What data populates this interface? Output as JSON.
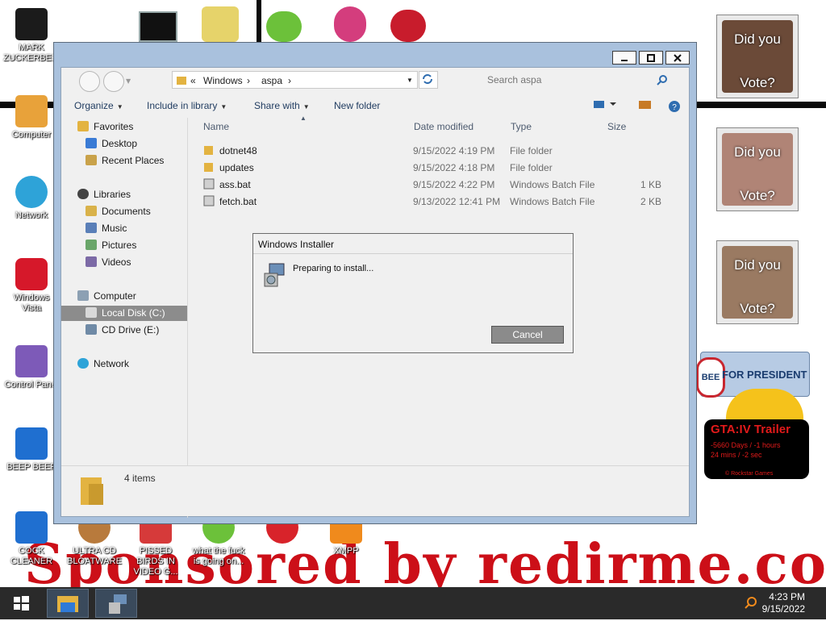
{
  "wallpaper": {
    "banner": "",
    "sponsor": "Sponsored by redirme.com"
  },
  "desktop_icons": [
    {
      "label": "MARK ZUCKERBERG"
    },
    {
      "label": "Computer"
    },
    {
      "label": "Network"
    },
    {
      "label": "Windows Vista"
    },
    {
      "label": "Control Panel"
    },
    {
      "label": "BEEP BEEP"
    },
    {
      "label": "COCK CLEANER"
    },
    {
      "label": "ULTRA CD BLOATWARE"
    },
    {
      "label": "PISSED BIRDS IN VIDEO G..."
    },
    {
      "label": "what the fuck is going on..."
    },
    {
      "label": ""
    },
    {
      "label": "XMPP"
    }
  ],
  "vote_widgets": [
    {
      "line1": "Did you",
      "line2": "Vote?"
    },
    {
      "line1": "Did you",
      "line2": "Vote?"
    },
    {
      "line1": "Did you",
      "line2": "Vote?"
    }
  ],
  "president_widget": {
    "badge": "BEE",
    "text": "FOR PRESIDENT"
  },
  "gta_widget": {
    "title": "GTA:IV Trailer",
    "line1": "-5660 Days / -1 hours",
    "line2": "24 mins / -2 sec",
    "footer": "© Rockstar Games"
  },
  "explorer": {
    "address": {
      "prefix": "«",
      "crumbs": [
        "Windows",
        "aspa"
      ]
    },
    "search_placeholder": "Search aspa",
    "toolbar": {
      "organize": "Organize",
      "include": "Include in library",
      "share": "Share with",
      "new_folder": "New folder"
    },
    "nav": {
      "favorites": "Favorites",
      "desktop": "Desktop",
      "recent": "Recent Places",
      "libraries": "Libraries",
      "documents": "Documents",
      "music": "Music",
      "pictures": "Pictures",
      "videos": "Videos",
      "computer": "Computer",
      "local_disk": "Local Disk (C:)",
      "cd_drive": "CD Drive (E:)",
      "network": "Network"
    },
    "columns": {
      "name": "Name",
      "date": "Date modified",
      "type": "Type",
      "size": "Size"
    },
    "files": [
      {
        "name": "dotnet48",
        "date": "9/15/2022 4:19 PM",
        "type": "File folder",
        "size": ""
      },
      {
        "name": "updates",
        "date": "9/15/2022 4:18 PM",
        "type": "File folder",
        "size": ""
      },
      {
        "name": "ass.bat",
        "date": "9/15/2022 4:22 PM",
        "type": "Windows Batch File",
        "size": "1 KB"
      },
      {
        "name": "fetch.bat",
        "date": "9/13/2022 12:41 PM",
        "type": "Windows Batch File",
        "size": "2 KB"
      }
    ],
    "status": "4 items"
  },
  "installer": {
    "title": "Windows Installer",
    "message": "Preparing to install...",
    "cancel": "Cancel"
  },
  "taskbar": {
    "time": "4:23 PM",
    "date": "9/15/2022"
  },
  "colors": {
    "nav_selected": "#8c8c8c",
    "link_blue": "#1e3a5f",
    "sponsor_red": "#cc0f18"
  }
}
